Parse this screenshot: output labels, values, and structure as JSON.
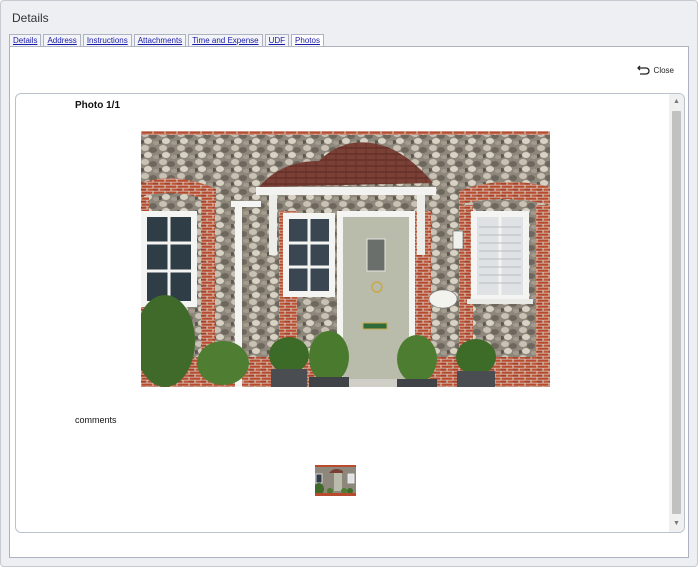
{
  "dialog": {
    "title": "Details",
    "tabs": [
      {
        "label": "Details"
      },
      {
        "label": "Address"
      },
      {
        "label": "Instructions"
      },
      {
        "label": "Attachments"
      },
      {
        "label": "Time and Expense"
      },
      {
        "label": "UDF"
      },
      {
        "label": "Photos"
      }
    ],
    "active_tab": "Photos"
  },
  "panel": {
    "close_label": "Close",
    "close_icon": "return-arrow-icon",
    "photo_title": "Photo 1/1",
    "comments": "comments",
    "scroll_up_icon": "triangle-up-icon",
    "scroll_down_icon": "triangle-down-icon"
  }
}
